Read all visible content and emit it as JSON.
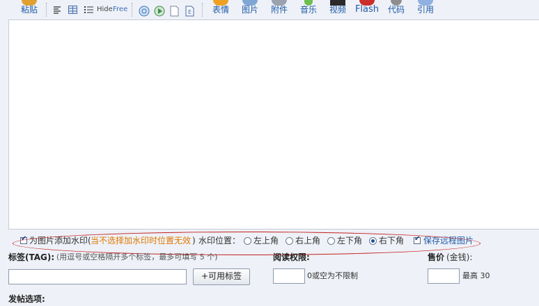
{
  "toolbar": {
    "paste": "粘贴",
    "emoticon": "表情",
    "image": "图片",
    "attachment": "附件",
    "music": "音乐",
    "video": "视频",
    "flash": "Flash",
    "code": "代码",
    "quote": "引用",
    "hide": "Hide",
    "free": "Free"
  },
  "watermark": {
    "add_label": "为图片添加水印(",
    "note": "当不选择加水印时位置无效",
    "close_paren": ")",
    "position_label": "水印位置：",
    "positions": [
      "左上角",
      "右上角",
      "左下角",
      "右下角"
    ],
    "selected_position": "右下角",
    "save_remote": "保存远程图片"
  },
  "tags": {
    "label": "标签(TAG):",
    "hint": "(用逗号或空格隔开多个标签，最多可填写 5 个)",
    "button": "+可用标签",
    "value": ""
  },
  "read_permission": {
    "label": "阅读权限:",
    "hint": "0或空为不限制",
    "value": ""
  },
  "price": {
    "label": "售价",
    "unit": "(金钱):",
    "hint": "最高 30",
    "value": ""
  },
  "post_options": {
    "label": "发帖选项:"
  },
  "colors": {
    "accent": "#1e5aa8",
    "note": "#e07800",
    "highlight_ring": "#c42020"
  }
}
